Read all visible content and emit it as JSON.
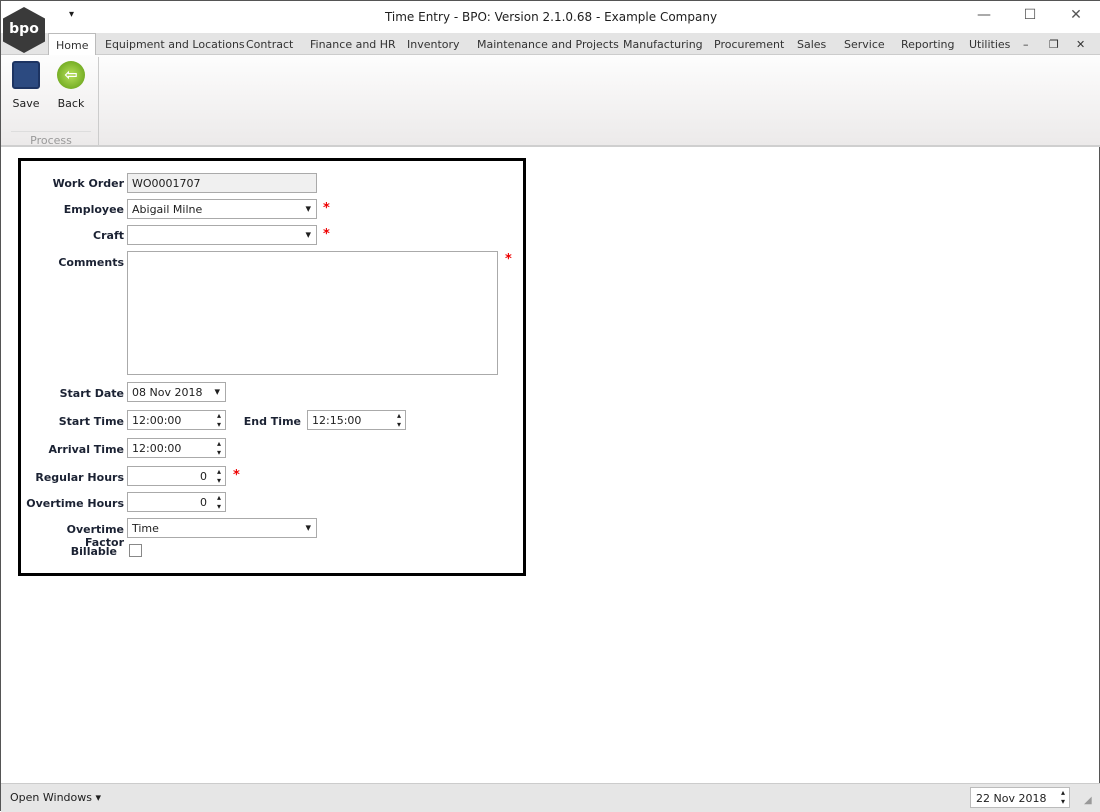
{
  "window": {
    "title": "Time Entry - BPO: Version 2.1.0.68 - Example Company",
    "logo": "bpo"
  },
  "tabs": [
    "Home",
    "Equipment and Locations",
    "Contract",
    "Finance and HR",
    "Inventory",
    "Maintenance and Projects",
    "Manufacturing",
    "Procurement",
    "Sales",
    "Service",
    "Reporting",
    "Utilities"
  ],
  "ribbon": {
    "save": "Save",
    "back": "Back",
    "group": "Process"
  },
  "form": {
    "work_order_label": "Work Order",
    "work_order": "WO0001707",
    "employee_label": "Employee",
    "employee": "Abigail Milne",
    "craft_label": "Craft",
    "craft": "",
    "comments_label": "Comments",
    "comments": "",
    "start_date_label": "Start Date",
    "start_date": "08 Nov 2018",
    "start_time_label": "Start Time",
    "start_time": "12:00:00",
    "end_time_label": "End Time",
    "end_time": "12:15:00",
    "arrival_time_label": "Arrival Time",
    "arrival_time": "12:00:00",
    "regular_hours_label": "Regular Hours",
    "regular_hours": "0",
    "overtime_hours_label": "Overtime Hours",
    "overtime_hours": "0",
    "overtime_factor_label": "Overtime Factor",
    "overtime_factor": "Time",
    "billable_label": "Billable",
    "required": "*"
  },
  "status": {
    "open_windows": "Open Windows ▾",
    "date": "22 Nov 2018"
  }
}
